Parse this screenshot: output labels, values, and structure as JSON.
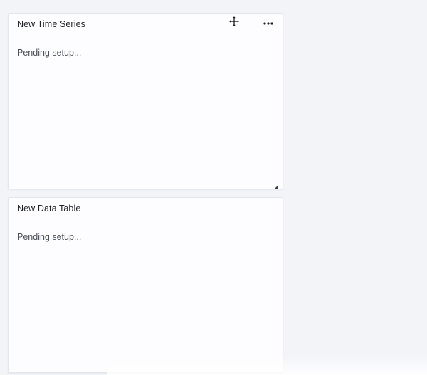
{
  "panels": [
    {
      "title": "New Time Series",
      "status": "Pending setup...",
      "icons": [
        "move-icon",
        "more-menu-icon",
        "resize-handle-icon"
      ]
    },
    {
      "title": "New Data Table",
      "status": "Pending setup..."
    }
  ],
  "colors": {
    "page_background": "#f2f4f8",
    "panel_background": "#fdfcfe",
    "panel_border": "#e4e6ec",
    "title_text": "#1f2328",
    "body_text": "#4a4f57"
  }
}
